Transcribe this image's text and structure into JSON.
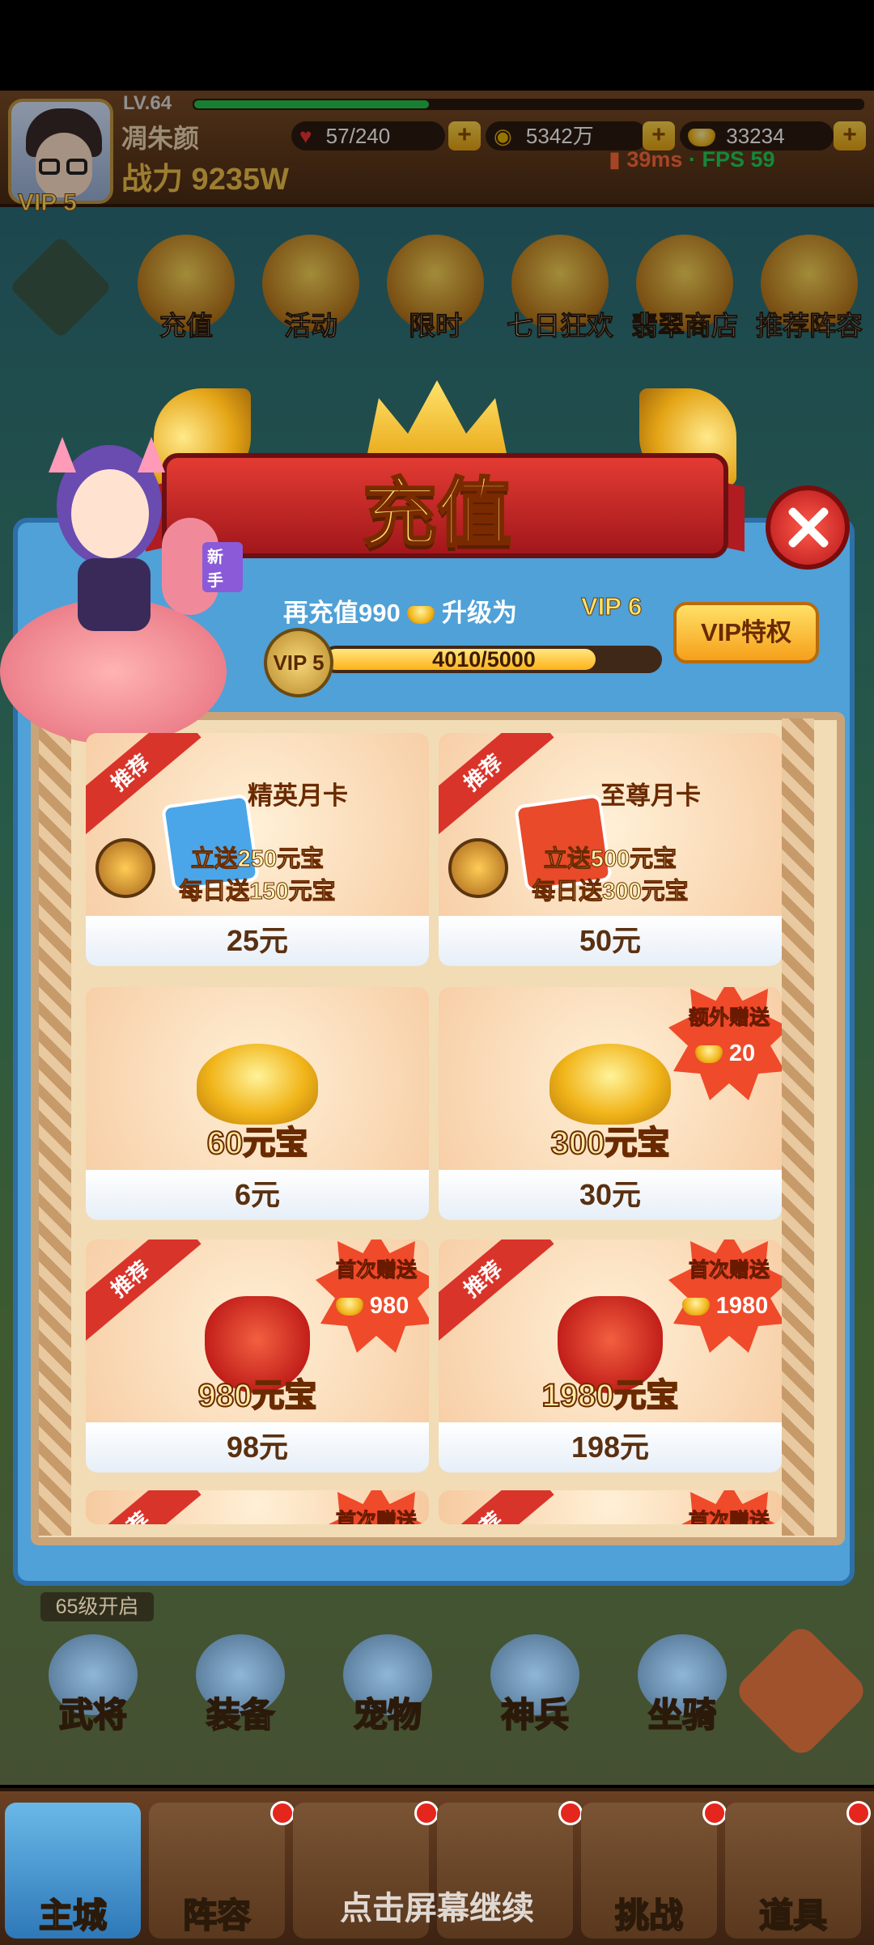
{
  "player": {
    "level": "LV.64",
    "name": "凋朱颜",
    "power": "战力 9235W",
    "vip": "VIP 5",
    "exp_fraction": 0.23
  },
  "resources": {
    "stamina": "57/240",
    "coins": "5342万",
    "ingots": "33234"
  },
  "network": {
    "ping": "39ms",
    "separator": "·",
    "fps": "FPS 59"
  },
  "top_menu": [
    {
      "label": "充值",
      "icon": "gold-ingot-icon"
    },
    {
      "label": "活动",
      "icon": "horn-icon"
    },
    {
      "label": "限时",
      "icon": "treasure-icon"
    },
    {
      "label": "七日狂欢",
      "icon": "gift-bag-icon"
    },
    {
      "label": "翡翠商店",
      "icon": "shop-icon"
    },
    {
      "label": "推荐阵容",
      "icon": "swords-icon"
    }
  ],
  "popup": {
    "title": "充值",
    "recharge_prefix": "再充值990",
    "recharge_suffix": "升级为",
    "next_vip": "VIP 6",
    "current_vip": "VIP 5",
    "progress_text": "4010/5000",
    "progress_fraction": 0.802,
    "vip_button": "VIP特权",
    "mascot_tag": "新手"
  },
  "cards": [
    {
      "tag": "推荐",
      "title": "精英月卡",
      "line1": "立送250元宝",
      "line2": "每日送150元宝",
      "price": "25元"
    },
    {
      "tag": "推荐",
      "title": "至尊月卡",
      "line1": "立送500元宝",
      "line2": "每日送300元宝",
      "price": "50元"
    },
    {
      "amount": "60元宝",
      "price": "6元"
    },
    {
      "amount": "300元宝",
      "price": "30元",
      "bonus_title": "额外赠送",
      "bonus_value": "20"
    },
    {
      "tag": "推荐",
      "amount": "980元宝",
      "price": "98元",
      "bonus_title": "首次赠送",
      "bonus_value": "980"
    },
    {
      "tag": "推荐",
      "amount": "1980元宝",
      "price": "198元",
      "bonus_title": "首次赠送",
      "bonus_value": "1980"
    },
    {
      "tag": "推荐",
      "bonus_title": "首次赠送"
    },
    {
      "tag": "推荐",
      "bonus_title": "首次赠送"
    }
  ],
  "level_open": "65级开启",
  "features": [
    "武将",
    "装备",
    "宠物",
    "神兵",
    "坐骑"
  ],
  "tabs": [
    "主城",
    "阵容",
    "",
    "",
    "挑战",
    "道具"
  ],
  "hint": "点击屏幕继续",
  "colors": {
    "accent_blue": "#4fa1d8",
    "accent_red": "#d9342a",
    "gold": "#f2b51a"
  }
}
